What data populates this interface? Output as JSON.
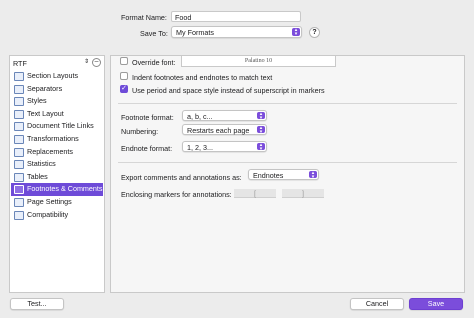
{
  "header": {
    "format_name_label": "Format Name:",
    "format_name_value": "Food",
    "save_to_label": "Save To:",
    "save_to_value": "My Formats",
    "help_label": "?"
  },
  "sidebar": {
    "format_selector": "RTF",
    "items": [
      {
        "label": "Section Layouts",
        "icon": "section-layouts-icon"
      },
      {
        "label": "Separators",
        "icon": "separators-icon"
      },
      {
        "label": "Styles",
        "icon": "styles-icon"
      },
      {
        "label": "Text Layout",
        "icon": "text-layout-icon"
      },
      {
        "label": "Document Title Links",
        "icon": "document-title-links-icon"
      },
      {
        "label": "Transformations",
        "icon": "transformations-icon"
      },
      {
        "label": "Replacements",
        "icon": "replacements-icon"
      },
      {
        "label": "Statistics",
        "icon": "statistics-icon"
      },
      {
        "label": "Tables",
        "icon": "tables-icon"
      },
      {
        "label": "Footnotes & Comments",
        "icon": "footnotes-comments-icon"
      },
      {
        "label": "Page Settings",
        "icon": "page-settings-icon"
      },
      {
        "label": "Compatibility",
        "icon": "compatibility-icon"
      }
    ],
    "selected_index": 9
  },
  "options": {
    "override_font_label": "Override font:",
    "override_font_checked": false,
    "font_preview": "Palatino 10",
    "indent_label": "Indent footnotes and endnotes to match text",
    "indent_checked": false,
    "period_style_label": "Use period and space style instead of superscript in markers",
    "period_style_checked": true
  },
  "formats": {
    "footnote_label": "Footnote format:",
    "footnote_value": "a, b, c...",
    "numbering_label": "Numbering:",
    "numbering_value": "Restarts each page",
    "endnote_label": "Endnote format:",
    "endnote_value": "1, 2, 3..."
  },
  "comments": {
    "export_label": "Export comments and annotations as:",
    "export_value": "Endnotes",
    "markers_label": "Enclosing markers for annotations:",
    "marker_open": "[",
    "marker_close": "]"
  },
  "footer": {
    "test_label": "Test...",
    "cancel_label": "Cancel",
    "save_label": "Save"
  },
  "colors": {
    "accent": "#7b4ddb",
    "selection": "#6e4bd8"
  }
}
